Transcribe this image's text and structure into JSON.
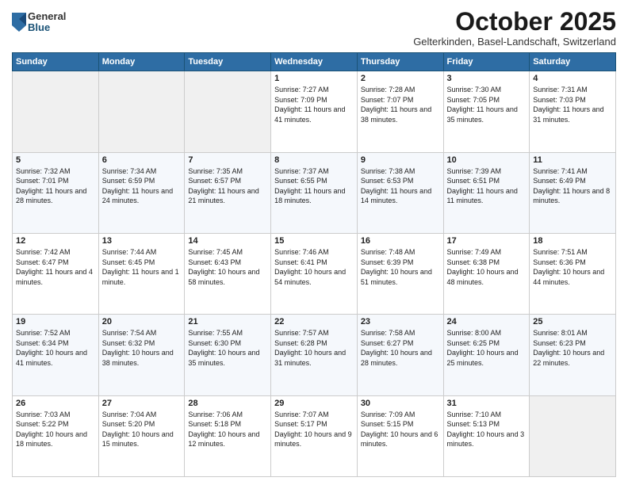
{
  "logo": {
    "general": "General",
    "blue": "Blue"
  },
  "header": {
    "month": "October 2025",
    "location": "Gelterkinden, Basel-Landschaft, Switzerland"
  },
  "days_of_week": [
    "Sunday",
    "Monday",
    "Tuesday",
    "Wednesday",
    "Thursday",
    "Friday",
    "Saturday"
  ],
  "weeks": [
    [
      {
        "day": "",
        "info": ""
      },
      {
        "day": "",
        "info": ""
      },
      {
        "day": "",
        "info": ""
      },
      {
        "day": "1",
        "info": "Sunrise: 7:27 AM\nSunset: 7:09 PM\nDaylight: 11 hours and 41 minutes."
      },
      {
        "day": "2",
        "info": "Sunrise: 7:28 AM\nSunset: 7:07 PM\nDaylight: 11 hours and 38 minutes."
      },
      {
        "day": "3",
        "info": "Sunrise: 7:30 AM\nSunset: 7:05 PM\nDaylight: 11 hours and 35 minutes."
      },
      {
        "day": "4",
        "info": "Sunrise: 7:31 AM\nSunset: 7:03 PM\nDaylight: 11 hours and 31 minutes."
      }
    ],
    [
      {
        "day": "5",
        "info": "Sunrise: 7:32 AM\nSunset: 7:01 PM\nDaylight: 11 hours and 28 minutes."
      },
      {
        "day": "6",
        "info": "Sunrise: 7:34 AM\nSunset: 6:59 PM\nDaylight: 11 hours and 24 minutes."
      },
      {
        "day": "7",
        "info": "Sunrise: 7:35 AM\nSunset: 6:57 PM\nDaylight: 11 hours and 21 minutes."
      },
      {
        "day": "8",
        "info": "Sunrise: 7:37 AM\nSunset: 6:55 PM\nDaylight: 11 hours and 18 minutes."
      },
      {
        "day": "9",
        "info": "Sunrise: 7:38 AM\nSunset: 6:53 PM\nDaylight: 11 hours and 14 minutes."
      },
      {
        "day": "10",
        "info": "Sunrise: 7:39 AM\nSunset: 6:51 PM\nDaylight: 11 hours and 11 minutes."
      },
      {
        "day": "11",
        "info": "Sunrise: 7:41 AM\nSunset: 6:49 PM\nDaylight: 11 hours and 8 minutes."
      }
    ],
    [
      {
        "day": "12",
        "info": "Sunrise: 7:42 AM\nSunset: 6:47 PM\nDaylight: 11 hours and 4 minutes."
      },
      {
        "day": "13",
        "info": "Sunrise: 7:44 AM\nSunset: 6:45 PM\nDaylight: 11 hours and 1 minute."
      },
      {
        "day": "14",
        "info": "Sunrise: 7:45 AM\nSunset: 6:43 PM\nDaylight: 10 hours and 58 minutes."
      },
      {
        "day": "15",
        "info": "Sunrise: 7:46 AM\nSunset: 6:41 PM\nDaylight: 10 hours and 54 minutes."
      },
      {
        "day": "16",
        "info": "Sunrise: 7:48 AM\nSunset: 6:39 PM\nDaylight: 10 hours and 51 minutes."
      },
      {
        "day": "17",
        "info": "Sunrise: 7:49 AM\nSunset: 6:38 PM\nDaylight: 10 hours and 48 minutes."
      },
      {
        "day": "18",
        "info": "Sunrise: 7:51 AM\nSunset: 6:36 PM\nDaylight: 10 hours and 44 minutes."
      }
    ],
    [
      {
        "day": "19",
        "info": "Sunrise: 7:52 AM\nSunset: 6:34 PM\nDaylight: 10 hours and 41 minutes."
      },
      {
        "day": "20",
        "info": "Sunrise: 7:54 AM\nSunset: 6:32 PM\nDaylight: 10 hours and 38 minutes."
      },
      {
        "day": "21",
        "info": "Sunrise: 7:55 AM\nSunset: 6:30 PM\nDaylight: 10 hours and 35 minutes."
      },
      {
        "day": "22",
        "info": "Sunrise: 7:57 AM\nSunset: 6:28 PM\nDaylight: 10 hours and 31 minutes."
      },
      {
        "day": "23",
        "info": "Sunrise: 7:58 AM\nSunset: 6:27 PM\nDaylight: 10 hours and 28 minutes."
      },
      {
        "day": "24",
        "info": "Sunrise: 8:00 AM\nSunset: 6:25 PM\nDaylight: 10 hours and 25 minutes."
      },
      {
        "day": "25",
        "info": "Sunrise: 8:01 AM\nSunset: 6:23 PM\nDaylight: 10 hours and 22 minutes."
      }
    ],
    [
      {
        "day": "26",
        "info": "Sunrise: 7:03 AM\nSunset: 5:22 PM\nDaylight: 10 hours and 18 minutes."
      },
      {
        "day": "27",
        "info": "Sunrise: 7:04 AM\nSunset: 5:20 PM\nDaylight: 10 hours and 15 minutes."
      },
      {
        "day": "28",
        "info": "Sunrise: 7:06 AM\nSunset: 5:18 PM\nDaylight: 10 hours and 12 minutes."
      },
      {
        "day": "29",
        "info": "Sunrise: 7:07 AM\nSunset: 5:17 PM\nDaylight: 10 hours and 9 minutes."
      },
      {
        "day": "30",
        "info": "Sunrise: 7:09 AM\nSunset: 5:15 PM\nDaylight: 10 hours and 6 minutes."
      },
      {
        "day": "31",
        "info": "Sunrise: 7:10 AM\nSunset: 5:13 PM\nDaylight: 10 hours and 3 minutes."
      },
      {
        "day": "",
        "info": ""
      }
    ]
  ]
}
